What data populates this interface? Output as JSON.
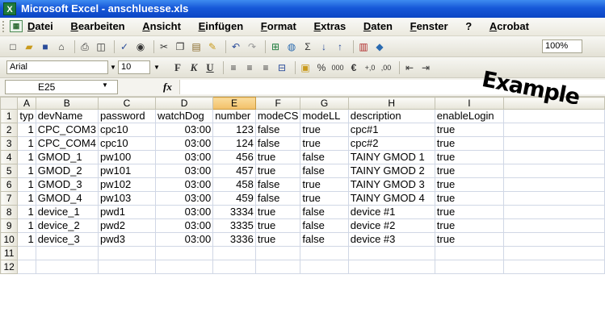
{
  "window": {
    "title": "Microsoft Excel - anschluesse.xls",
    "app_icon": "excel-icon"
  },
  "menu": [
    "Datei",
    "Bearbeiten",
    "Ansicht",
    "Einfügen",
    "Format",
    "Extras",
    "Daten",
    "Fenster",
    "?",
    "Acrobat"
  ],
  "toolbar": {
    "zoom": "100%"
  },
  "format_toolbar": {
    "font": "Arial",
    "size": "10",
    "bold": "F",
    "italic": "K",
    "underline": "U",
    "percent": "%",
    "thousands": "000",
    "currency": "€",
    "inc_decimal": "+,0",
    "dec_decimal": ",00"
  },
  "overlay": {
    "watermark": "Example"
  },
  "formula_bar": {
    "name_box": "E25",
    "fx": "fx",
    "formula": ""
  },
  "sheet": {
    "columns": [
      "A",
      "B",
      "C",
      "D",
      "E",
      "F",
      "G",
      "H",
      "I"
    ],
    "selected_column": "E",
    "rows": [
      [
        "1",
        "typ",
        "devName",
        "password",
        "watchDog",
        "number",
        "modeCS",
        "modeLL",
        "description",
        "enableLogin"
      ],
      [
        "2",
        "1",
        "CPC_COM3",
        "cpc10",
        "03:00",
        "123",
        "false",
        "true",
        "cpc#1",
        "true"
      ],
      [
        "3",
        "1",
        "CPC_COM4",
        "cpc10",
        "03:00",
        "124",
        "false",
        "true",
        "cpc#2",
        "true"
      ],
      [
        "4",
        "1",
        "GMOD_1",
        "pw100",
        "03:00",
        "456",
        "true",
        "false",
        "TAINY GMOD 1",
        "true"
      ],
      [
        "5",
        "1",
        "GMOD_2",
        "pw101",
        "03:00",
        "457",
        "true",
        "false",
        "TAINY GMOD 2",
        "true"
      ],
      [
        "6",
        "1",
        "GMOD_3",
        "pw102",
        "03:00",
        "458",
        "false",
        "true",
        "TAINY GMOD 3",
        "true"
      ],
      [
        "7",
        "1",
        "GMOD_4",
        "pw103",
        "03:00",
        "459",
        "false",
        "true",
        "TAINY GMOD 4",
        "true"
      ],
      [
        "8",
        "1",
        "device_1",
        "pwd1",
        "03:00",
        "3334",
        "true",
        "false",
        "device #1",
        "true"
      ],
      [
        "9",
        "1",
        "device_2",
        "pwd2",
        "03:00",
        "3335",
        "true",
        "false",
        "device #2",
        "true"
      ],
      [
        "10",
        "1",
        "device_3",
        "pwd3",
        "03:00",
        "3336",
        "true",
        "false",
        "device #3",
        "true"
      ],
      [
        "11",
        "",
        "",
        "",
        "",
        "",
        "",
        "",
        "",
        ""
      ],
      [
        "12",
        "",
        "",
        "",
        "",
        "",
        "",
        "",
        "",
        ""
      ]
    ]
  }
}
